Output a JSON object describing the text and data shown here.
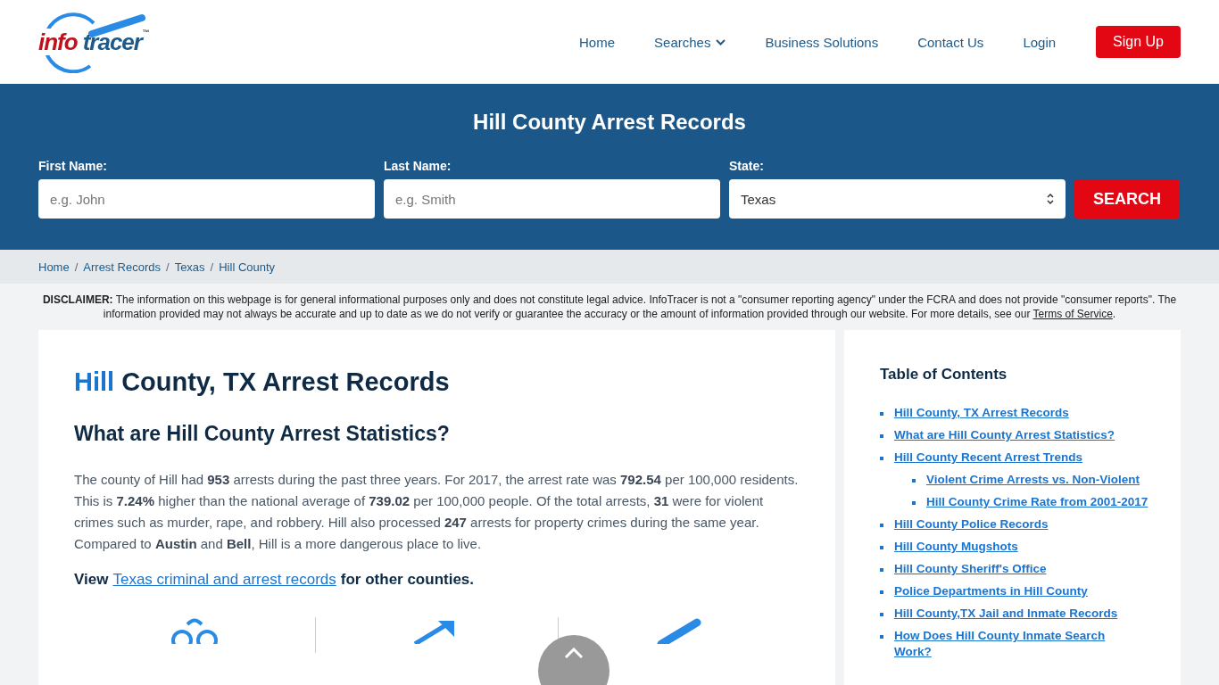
{
  "logo": {
    "part_1": "info",
    "part_2": "tracer",
    "mark": "™"
  },
  "nav": {
    "items": [
      {
        "label": "Home",
        "kind": "link"
      },
      {
        "label": "Searches",
        "kind": "dropdown"
      },
      {
        "label": "Business Solutions",
        "kind": "link"
      },
      {
        "label": "Contact Us",
        "kind": "link"
      },
      {
        "label": "Login",
        "kind": "link"
      }
    ],
    "signup": "Sign Up"
  },
  "search": {
    "title": "Hill County Arrest Records",
    "first_name": {
      "label": "First Name:",
      "placeholder": "e.g. John"
    },
    "last_name": {
      "label": "Last Name:",
      "placeholder": "e.g. Smith"
    },
    "state": {
      "label": "State:",
      "value": "Texas"
    },
    "button": "SEARCH"
  },
  "breadcrumb": {
    "separator": "/",
    "items": [
      "Home",
      "Arrest Records",
      "Texas",
      "Hill County"
    ]
  },
  "disclaimer": {
    "text": "**DISCLAIMER:** The information on this webpage is for general informational purposes only and does not constitute legal advice. InfoTracer is not a \"consumer reporting agency\" under the FCRA and does not provide \"consumer reports\". The information provided may not always be accurate and up to date as we do not verify or guarantee the accuracy or the amount of information provided through our website. For more details, see our",
    "link": "Terms of Service",
    "end": "."
  },
  "article": {
    "title_highlight": "Hill",
    "title_rest": "County, TX Arrest Records",
    "heading": "What are Hill County Arrest Statistics?",
    "paragraph": "The county of Hill had **953** arrests during the past three years. For 2017, the arrest rate was **792.54** per 100,000 residents. This is **7.24%** higher than the national average of **739.02** per 100,000 people. Of the total arrests, **31** were for violent crimes such as murder, rape, and robbery. Hill also processed **247** arrests for property crimes during the same year. Compared to **Austin** and **Bell**, Hill is a more dangerous place to live.",
    "view_before": "View",
    "view_link": "Texas criminal and arrest records",
    "view_after": "for other counties."
  },
  "toc": {
    "title": "Table of Contents",
    "items": [
      {
        "label": "Hill County, TX Arrest Records"
      },
      {
        "label": "What are Hill County Arrest Statistics?"
      },
      {
        "label": "Hill County Recent Arrest Trends",
        "children": [
          {
            "label": "Violent Crime Arrests vs. Non-Violent"
          },
          {
            "label": "Hill County Crime Rate from 2001-2017"
          }
        ]
      },
      {
        "label": "Hill County Police Records"
      },
      {
        "label": "Hill County Mugshots"
      },
      {
        "label": "Hill County Sheriff's Office"
      },
      {
        "label": "Police Departments in Hill County"
      },
      {
        "label": "Hill County,TX Jail and Inmate Records"
      },
      {
        "label": "How Does Hill County Inmate Search Work?"
      }
    ]
  }
}
